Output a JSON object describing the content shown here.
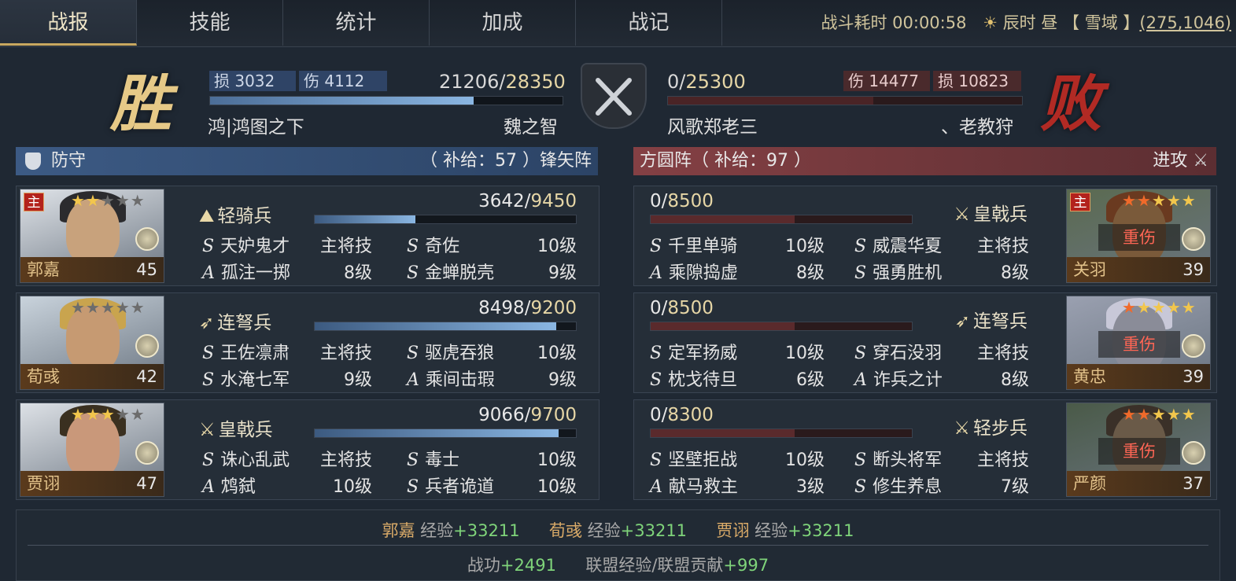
{
  "tabs": [
    "战报",
    "技能",
    "统计",
    "加成",
    "战记"
  ],
  "battle_info": {
    "duration_label": "战斗耗时",
    "duration": "00:00:58",
    "time_label": "辰时 昼",
    "region": "【 雪域 】",
    "coords": "(275,1046)"
  },
  "left": {
    "result": "胜",
    "loss_label": "损",
    "loss": "3032",
    "dmg_label": "伤",
    "dmg": "4112",
    "troops_current": "21206",
    "troops_max": "28350",
    "troops_ratio": 0.748,
    "guild": "鸿|鸿图之下",
    "player": "魏之智",
    "stance": "防守",
    "supply": "（ 补给：57 ）锋矢阵"
  },
  "right": {
    "result": "败",
    "dmg_label": "伤",
    "dmg": "14477",
    "loss_label": "损",
    "loss": "10823",
    "troops_current": "0",
    "troops_max": "25300",
    "troops_ratio": 0,
    "player": "风歌郑老三",
    "guild": "、老教狩",
    "formation": "方圆阵（ 补给：97 ）",
    "stance": "进攻"
  },
  "left_generals": [
    {
      "name": "郭嘉",
      "level": "45",
      "main": "主",
      "stars_on": 2,
      "troop": "轻骑兵",
      "cur": "3642",
      "max": "9450",
      "ratio": 0.385,
      "skills": [
        [
          "S",
          "天妒鬼才",
          "主将技"
        ],
        [
          "S",
          "奇佐",
          "10级"
        ],
        [
          "A",
          "孤注一掷",
          "8级"
        ],
        [
          "S",
          "金蝉脱壳",
          "9级"
        ]
      ]
    },
    {
      "name": "荀彧",
      "level": "42",
      "main": "",
      "stars_on": 0,
      "troop": "连弩兵",
      "cur": "8498",
      "max": "9200",
      "ratio": 0.924,
      "skills": [
        [
          "S",
          "王佐凛肃",
          "主将技"
        ],
        [
          "S",
          "驱虎吞狼",
          "10级"
        ],
        [
          "S",
          "水淹七军",
          "9级"
        ],
        [
          "A",
          "乘间击瑕",
          "9级"
        ]
      ]
    },
    {
      "name": "贾诩",
      "level": "47",
      "main": "",
      "stars_on": 3,
      "troop": "皇戟兵",
      "cur": "9066",
      "max": "9700",
      "ratio": 0.935,
      "skills": [
        [
          "S",
          "诛心乱武",
          "主将技"
        ],
        [
          "S",
          "毒士",
          "10级"
        ],
        [
          "A",
          "鸩弑",
          "10级"
        ],
        [
          "S",
          "兵者诡道",
          "10级"
        ]
      ]
    }
  ],
  "right_generals": [
    {
      "name": "关羽",
      "level": "39",
      "main": "主",
      "stars_on": 2,
      "status": "重伤",
      "troop": "皇戟兵",
      "cur": "0",
      "max": "8500",
      "ratio": 0,
      "skills": [
        [
          "S",
          "千里单骑",
          "10级"
        ],
        [
          "S",
          "威震华夏",
          "主将技"
        ],
        [
          "A",
          "乘隙捣虚",
          "8级"
        ],
        [
          "S",
          "强勇胜机",
          "8级"
        ]
      ]
    },
    {
      "name": "黄忠",
      "level": "39",
      "main": "",
      "stars_on": 1,
      "status": "重伤",
      "troop": "连弩兵",
      "cur": "0",
      "max": "8500",
      "ratio": 0,
      "skills": [
        [
          "S",
          "定军扬威",
          "10级"
        ],
        [
          "S",
          "穿石没羽",
          "主将技"
        ],
        [
          "S",
          "枕戈待旦",
          "6级"
        ],
        [
          "A",
          "诈兵之计",
          "8级"
        ]
      ]
    },
    {
      "name": "严颜",
      "level": "37",
      "main": "",
      "stars_on": 2,
      "status": "重伤",
      "troop": "轻步兵",
      "cur": "0",
      "max": "8300",
      "ratio": 0,
      "skills": [
        [
          "S",
          "坚壁拒战",
          "10级"
        ],
        [
          "S",
          "断头将军",
          "主将技"
        ],
        [
          "A",
          "献马救主",
          "3级"
        ],
        [
          "S",
          "修生养息",
          "7级"
        ]
      ]
    }
  ],
  "footer": {
    "exp": [
      {
        "name": "郭嘉",
        "label": "经验",
        "value": "+33211"
      },
      {
        "name": "荀彧",
        "label": "经验",
        "value": "+33211"
      },
      {
        "name": "贾诩",
        "label": "经验",
        "value": "+33211"
      }
    ],
    "merit_label": "战功",
    "merit": "+2491",
    "alliance_label": "联盟经验/联盟贡献",
    "alliance": "+997"
  },
  "colors": {
    "gold": "#d9aa68",
    "green": "#7fd47a",
    "defense_blue": "#2e4a6e",
    "attack_red": "#6a2e32",
    "hp_blue": "#6f9fd0",
    "hp_red": "#7a2c2c"
  }
}
